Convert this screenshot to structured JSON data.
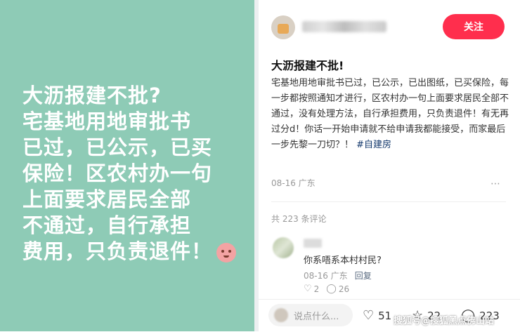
{
  "cover": {
    "lines": [
      "大沥报建不批?",
      "宅基地用地审批书",
      "已过，已公示，已买",
      "保险！区农村办一句",
      "上面要求居民全部",
      "不通过，自行承担",
      "费用，只负责退件！"
    ]
  },
  "author": {
    "follow_label": "关注"
  },
  "post": {
    "title": "大沥报建不批!",
    "body": "宅基地用地审批书已过，已公示，已出图纸，已买保险，每一步都按照通知才进行，区农村办一句上面要求居民全部不通过，没有处理方法，自行承担费用，只负责退件！有无再过分d！你话一开始申请就不给申请我都能接受，而家最后一步先黎一刀切？！",
    "hashtag": "#自建房",
    "date_location": "08-16 广东",
    "more_icon": "more-dots-icon"
  },
  "comments": {
    "count_label": "共 223 条评论",
    "items": [
      {
        "text": "你系唔系本村村民?",
        "meta": "08-16 广东",
        "reply_label": "回复",
        "likes": "2",
        "replies": "26"
      }
    ]
  },
  "bottom_bar": {
    "input_placeholder": "说点什么...",
    "likes": "51",
    "favorites": "22",
    "comments": "223"
  },
  "watermark": "搜狐号@搜狐黑点佛山站",
  "colors": {
    "cover_bg": "#8ecbb6",
    "follow_bg": "#ff2e4d",
    "hashtag": "#13386c"
  }
}
